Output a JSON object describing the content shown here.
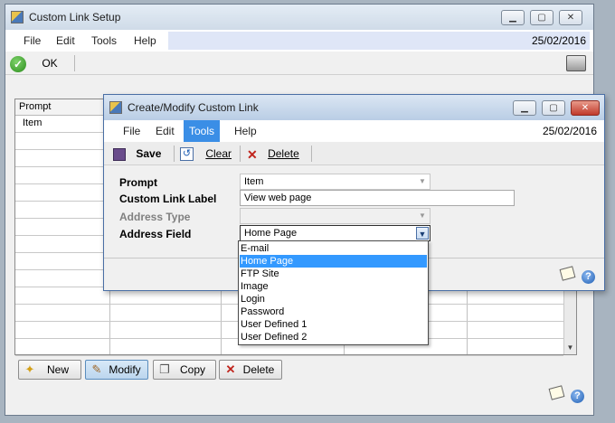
{
  "outer_window": {
    "title": "Custom Link Setup",
    "menu": [
      "File",
      "Edit",
      "Tools",
      "Help"
    ],
    "date": "25/02/2016",
    "toolbar": {
      "ok_label": "OK"
    },
    "grid": {
      "column_header": "Prompt",
      "rows": [
        "Item"
      ]
    },
    "buttons": {
      "new": "New",
      "modify": "Modify",
      "copy": "Copy",
      "delete": "Delete"
    }
  },
  "dialog": {
    "title": "Create/Modify Custom Link",
    "menu": [
      "File",
      "Edit",
      "Tools",
      "Help"
    ],
    "active_menu": "Tools",
    "date": "25/02/2016",
    "toolbar": {
      "save": "Save",
      "clear": "Clear",
      "delete": "Delete"
    },
    "fields": {
      "prompt_label": "Prompt",
      "prompt_value": "Item",
      "link_label_label": "Custom Link Label",
      "link_label_value": "View web page",
      "address_type_label": "Address Type",
      "address_type_value": "",
      "address_field_label": "Address Field",
      "address_field_value": "Home Page"
    },
    "address_field_options": [
      "E-mail",
      "Home Page",
      "FTP Site",
      "Image",
      "Login",
      "Password",
      "User Defined 1",
      "User Defined 2"
    ],
    "selected_option": "Home Page"
  },
  "colors": {
    "selection": "#3399ff",
    "active_menu": "#3a8ee6",
    "close_button": "#c0392b"
  }
}
